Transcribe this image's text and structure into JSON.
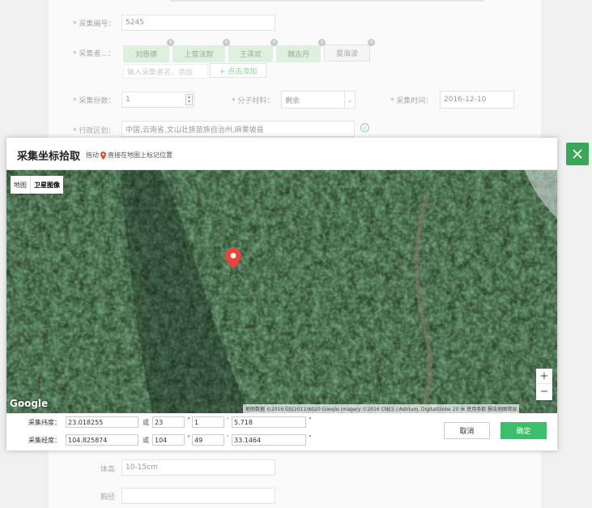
{
  "form": {
    "sample_no_label": "* 采集编号：",
    "sample_no_value": "5245",
    "collectors_label": "* 采集者...：",
    "collectors": [
      "刘恩德",
      "上官法智",
      "王泽欢",
      "魏志丹",
      "莫海波"
    ],
    "collector_placeholder": "输入采集者名，添加",
    "add_collector": "+ 点击添加",
    "copies_label": "* 采集份数：",
    "copies_value": "1",
    "material_label": "* 分子材料：",
    "material_value": "剩余",
    "date_label": "* 采集时间：",
    "date_value": "2016-12-10",
    "region_label": "* 行政区划：",
    "region_value": "中国,云南省,文山壮族苗族自治州,麻栗坡县",
    "height_label": "体高",
    "height_value": "10-15cm",
    "dbh_label": "胸径"
  },
  "dialog": {
    "title": "采集坐标拾取",
    "hint_prefix": "拖动",
    "hint_suffix": "直接在地图上标记位置",
    "map_type_map": "地图",
    "map_type_satellite": "卫星图像",
    "zoom_in": "+",
    "zoom_out": "−",
    "google": "Google",
    "attribution": "地图数据 ©2016 GS(2011)6020 Google Imagery ©2016 CNES / Astrium, DigitalGlobe   20 米   使用条款   报告地图错误",
    "lat_label": "采集纬度：",
    "lat_decimal": "23.018255",
    "lat_or": "或",
    "lat_deg": "23",
    "lat_min": "1",
    "lat_sec": "5.718",
    "lng_label": "采集经度：",
    "lng_decimal": "104.825874",
    "lng_or": "或",
    "lng_deg": "104",
    "lng_min": "49",
    "lng_sec": "33.1464",
    "deg_sym": "°",
    "min_sym": "'",
    "sec_sym": "\"",
    "cancel": "取消",
    "confirm": "确定"
  },
  "colors": {
    "accent": "#3cbf6b",
    "close": "#3aa65a",
    "pin": "#e8453c"
  }
}
